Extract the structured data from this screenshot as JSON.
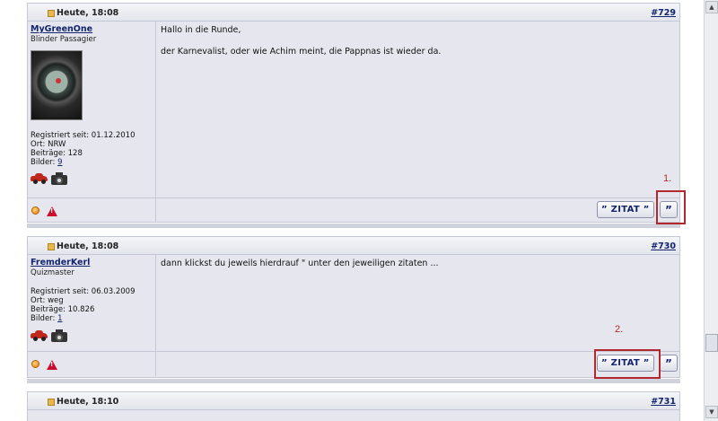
{
  "posts": [
    {
      "date_label": "Heute, 18:08",
      "number": "#729",
      "username": "MyGreenOne",
      "usertitle": "Blinder Passagier",
      "registered": "Registriert seit: 01.12.2010",
      "location": "Ort: NRW",
      "posts_count": "Beiträge: 128",
      "pictures_label": "Bilder: ",
      "pictures_value": "9",
      "message": [
        "Hallo in die Runde,",
        "der Karnevalist, oder wie Achim meint, die Pappnas ist wieder da."
      ]
    },
    {
      "date_label": "Heute, 18:08",
      "number": "#730",
      "username": "FremderKerl",
      "usertitle": "Quizmaster",
      "registered": "Registriert seit: 06.03.2009",
      "location": "Ort: weg",
      "posts_count": "Beiträge: 10.826",
      "pictures_label": "Bilder: ",
      "pictures_value": "1",
      "message": [
        "dann klickst du jeweils hierdrauf \" unter den jeweiligen zitaten ..."
      ]
    },
    {
      "date_label": "Heute, 18:10",
      "number": "#731"
    }
  ],
  "buttons": {
    "zitat_label": "” ZITAT ”",
    "quote_label": "”"
  },
  "annotations": {
    "marker1": "1.",
    "marker2": "2."
  },
  "colors": {
    "accent_link": "#12246f",
    "annotation_red": "#b3282d",
    "post_bg": "#e6e7ee"
  }
}
